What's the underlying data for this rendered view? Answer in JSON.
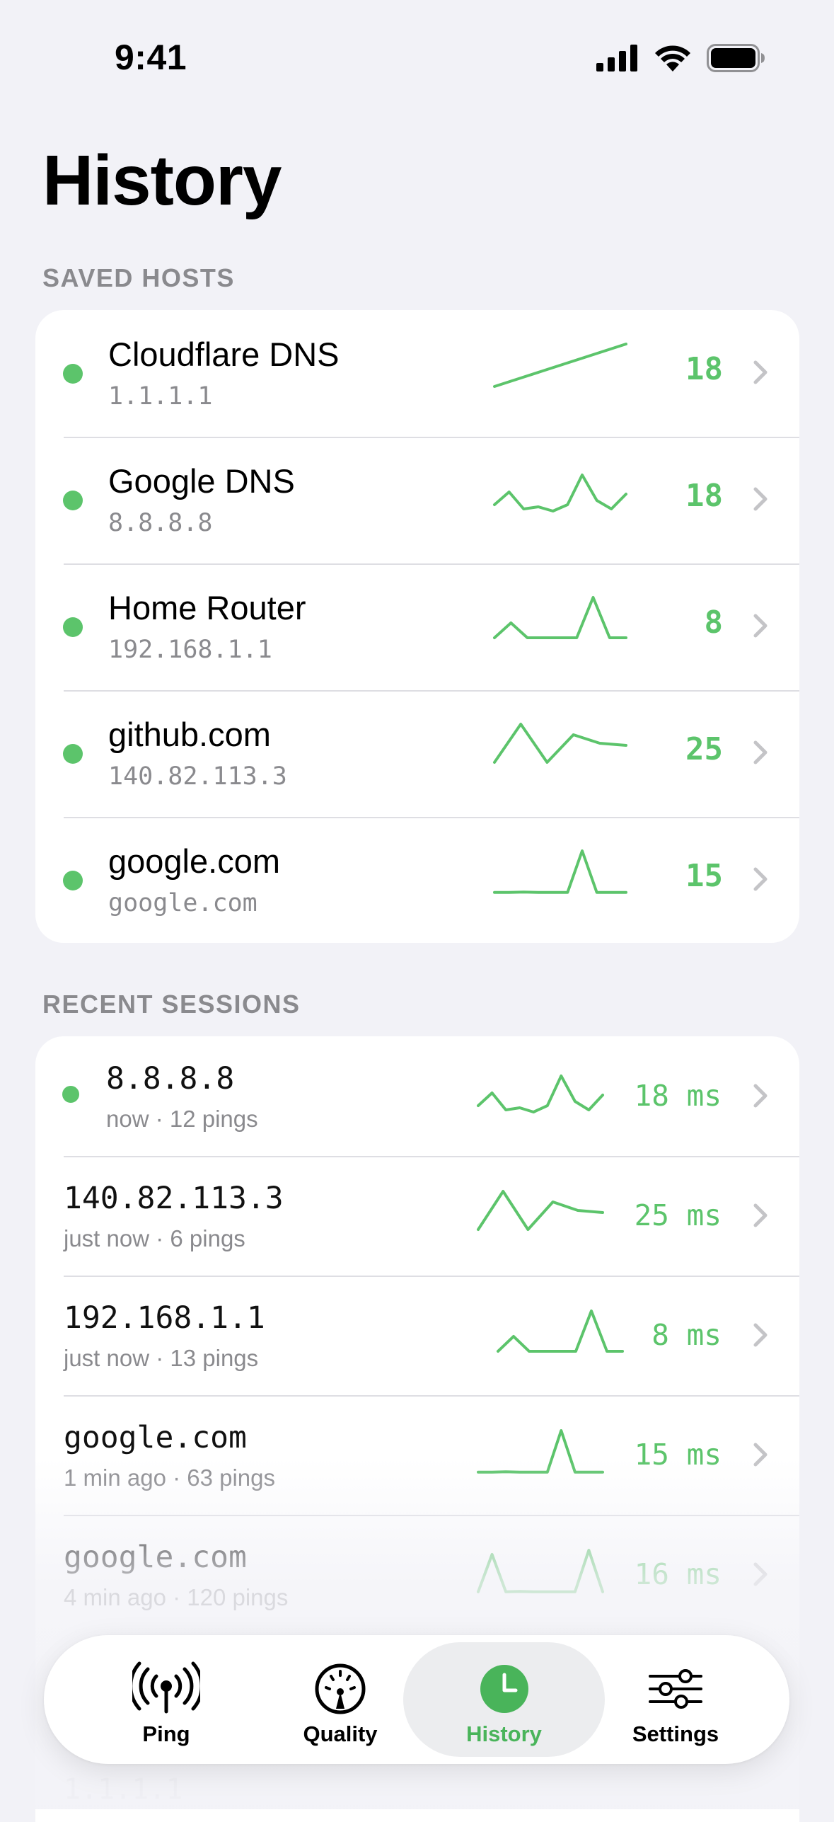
{
  "status_bar": {
    "time": "9:41"
  },
  "page": {
    "title": "History"
  },
  "saved_hosts": {
    "header": "SAVED HOSTS",
    "items": [
      {
        "name": "Cloudflare DNS",
        "address": "1.1.1.1",
        "value": "18",
        "status": "online",
        "sparkline": [
          0,
          0.2,
          0.4,
          0.6,
          0.8,
          1.0
        ]
      },
      {
        "name": "Google DNS",
        "address": "8.8.8.8",
        "value": "18",
        "status": "online",
        "sparkline": [
          0.2,
          0.5,
          0.1,
          0.15,
          0.05,
          0.2,
          0.9,
          0.3,
          0.1,
          0.45
        ]
      },
      {
        "name": "Home Router",
        "address": "192.168.1.1",
        "value": "8",
        "status": "online",
        "sparkline": [
          0.05,
          0.4,
          0.05,
          0.05,
          0.05,
          0.05,
          1.0,
          0.05,
          0.05
        ]
      },
      {
        "name": "github.com",
        "address": "140.82.113.3",
        "value": "25",
        "status": "online",
        "sparkline": [
          0.1,
          1.0,
          0.1,
          0.75,
          0.55,
          0.5
        ]
      },
      {
        "name": "google.com",
        "address": "google.com",
        "value": "15",
        "status": "online",
        "sparkline": [
          0.02,
          0.02,
          0.03,
          0.02,
          0.02,
          0.02,
          1.0,
          0.02,
          0.02,
          0.02
        ]
      }
    ]
  },
  "recent_sessions": {
    "header": "RECENT SESSIONS",
    "items": [
      {
        "address": "8.8.8.8",
        "meta": "now · 12 pings",
        "value": "18 ms",
        "active": true,
        "sparkline": [
          0.2,
          0.5,
          0.1,
          0.15,
          0.05,
          0.2,
          0.9,
          0.3,
          0.1,
          0.45
        ]
      },
      {
        "address": "140.82.113.3",
        "meta": "just now · 6 pings",
        "value": "25 ms",
        "active": false,
        "sparkline": [
          0.1,
          1.0,
          0.1,
          0.75,
          0.55,
          0.5
        ]
      },
      {
        "address": "192.168.1.1",
        "meta": "just now · 13 pings",
        "value": "8 ms",
        "active": false,
        "sparkline": [
          0.05,
          0.4,
          0.05,
          0.05,
          0.05,
          0.05,
          1.0,
          0.05,
          0.05
        ]
      },
      {
        "address": "google.com",
        "meta": "1 min ago · 63 pings",
        "value": "15 ms",
        "active": false,
        "sparkline": [
          0.02,
          0.02,
          0.03,
          0.02,
          0.02,
          0.02,
          1.0,
          0.02,
          0.02,
          0.02
        ]
      },
      {
        "address": "google.com",
        "meta": "4 min ago · 120 pings",
        "value": "16 ms",
        "active": false,
        "sparkline": [
          0.02,
          0.9,
          0.02,
          0.03,
          0.02,
          0.02,
          0.02,
          0.02,
          1.0,
          0.02
        ]
      }
    ],
    "partial_row": {
      "address": "1.1.1.1"
    }
  },
  "tab_bar": {
    "tabs": [
      {
        "label": "Ping",
        "icon": "antenna-icon",
        "active": false
      },
      {
        "label": "Quality",
        "icon": "gauge-icon",
        "active": false
      },
      {
        "label": "History",
        "icon": "clock-icon",
        "active": true
      },
      {
        "label": "Settings",
        "icon": "sliders-icon",
        "active": false
      }
    ]
  },
  "colors": {
    "accent_green": "#5CC46B",
    "background": "#F2F2F7",
    "secondary_text": "#8A8A8E"
  }
}
